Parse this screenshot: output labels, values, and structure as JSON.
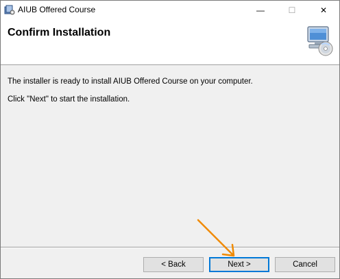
{
  "window": {
    "title": "AIUB Offered Course",
    "minimize_glyph": "—",
    "maximize_glyph": "☐",
    "close_glyph": "✕"
  },
  "header": {
    "title": "Confirm Installation",
    "icon": "computer-disc-icon"
  },
  "content": {
    "line1": "The installer is ready to install AIUB Offered Course on your computer.",
    "line2": "Click \"Next\" to start the installation."
  },
  "buttons": {
    "back": "< Back",
    "next": "Next >",
    "cancel": "Cancel"
  },
  "annotation": {
    "arrow_color": "#f08a00",
    "points_to": "next-button"
  },
  "colors": {
    "focus_border": "#0078d7"
  }
}
